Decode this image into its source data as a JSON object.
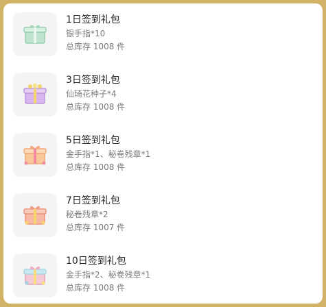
{
  "items": [
    {
      "title": "1日签到礼包",
      "reward": "银手指*10",
      "stock": "总库存 1008 件",
      "icon": "green-gift-box-icon",
      "colors": {
        "main": "#bfe3cf",
        "dark": "#8cc7a8",
        "accent": "#e9f7ef"
      }
    },
    {
      "title": "3日签到礼包",
      "reward": "仙琦花种子*4",
      "stock": "总库存 1008 件",
      "icon": "purple-gift-box-icon",
      "colors": {
        "main": "#d8b7ee",
        "dark": "#b58ad6",
        "accent": "#f5d56a"
      }
    },
    {
      "title": "5日签到礼包",
      "reward": "金手指*1、秘卷残章*1",
      "stock": "总库存 1008 件",
      "icon": "orange-gift-box-icon",
      "colors": {
        "main": "#f8c89b",
        "dark": "#ef9f67",
        "accent": "#f48aa0"
      }
    },
    {
      "title": "7日签到礼包",
      "reward": "秘卷残章*2",
      "stock": "总库存 1007 件",
      "icon": "peach-gift-box-icon",
      "colors": {
        "main": "#f7b8a3",
        "dark": "#e9876d",
        "accent": "#f6d36c"
      }
    },
    {
      "title": "10日签到礼包",
      "reward": "金手指*2、秘卷残章*1",
      "stock": "总库存 1008 件",
      "icon": "pastel-gift-box-icon",
      "colors": {
        "main": "#f6c9d6",
        "dark": "#9fd3e0",
        "accent": "#f8dd7a"
      }
    }
  ]
}
